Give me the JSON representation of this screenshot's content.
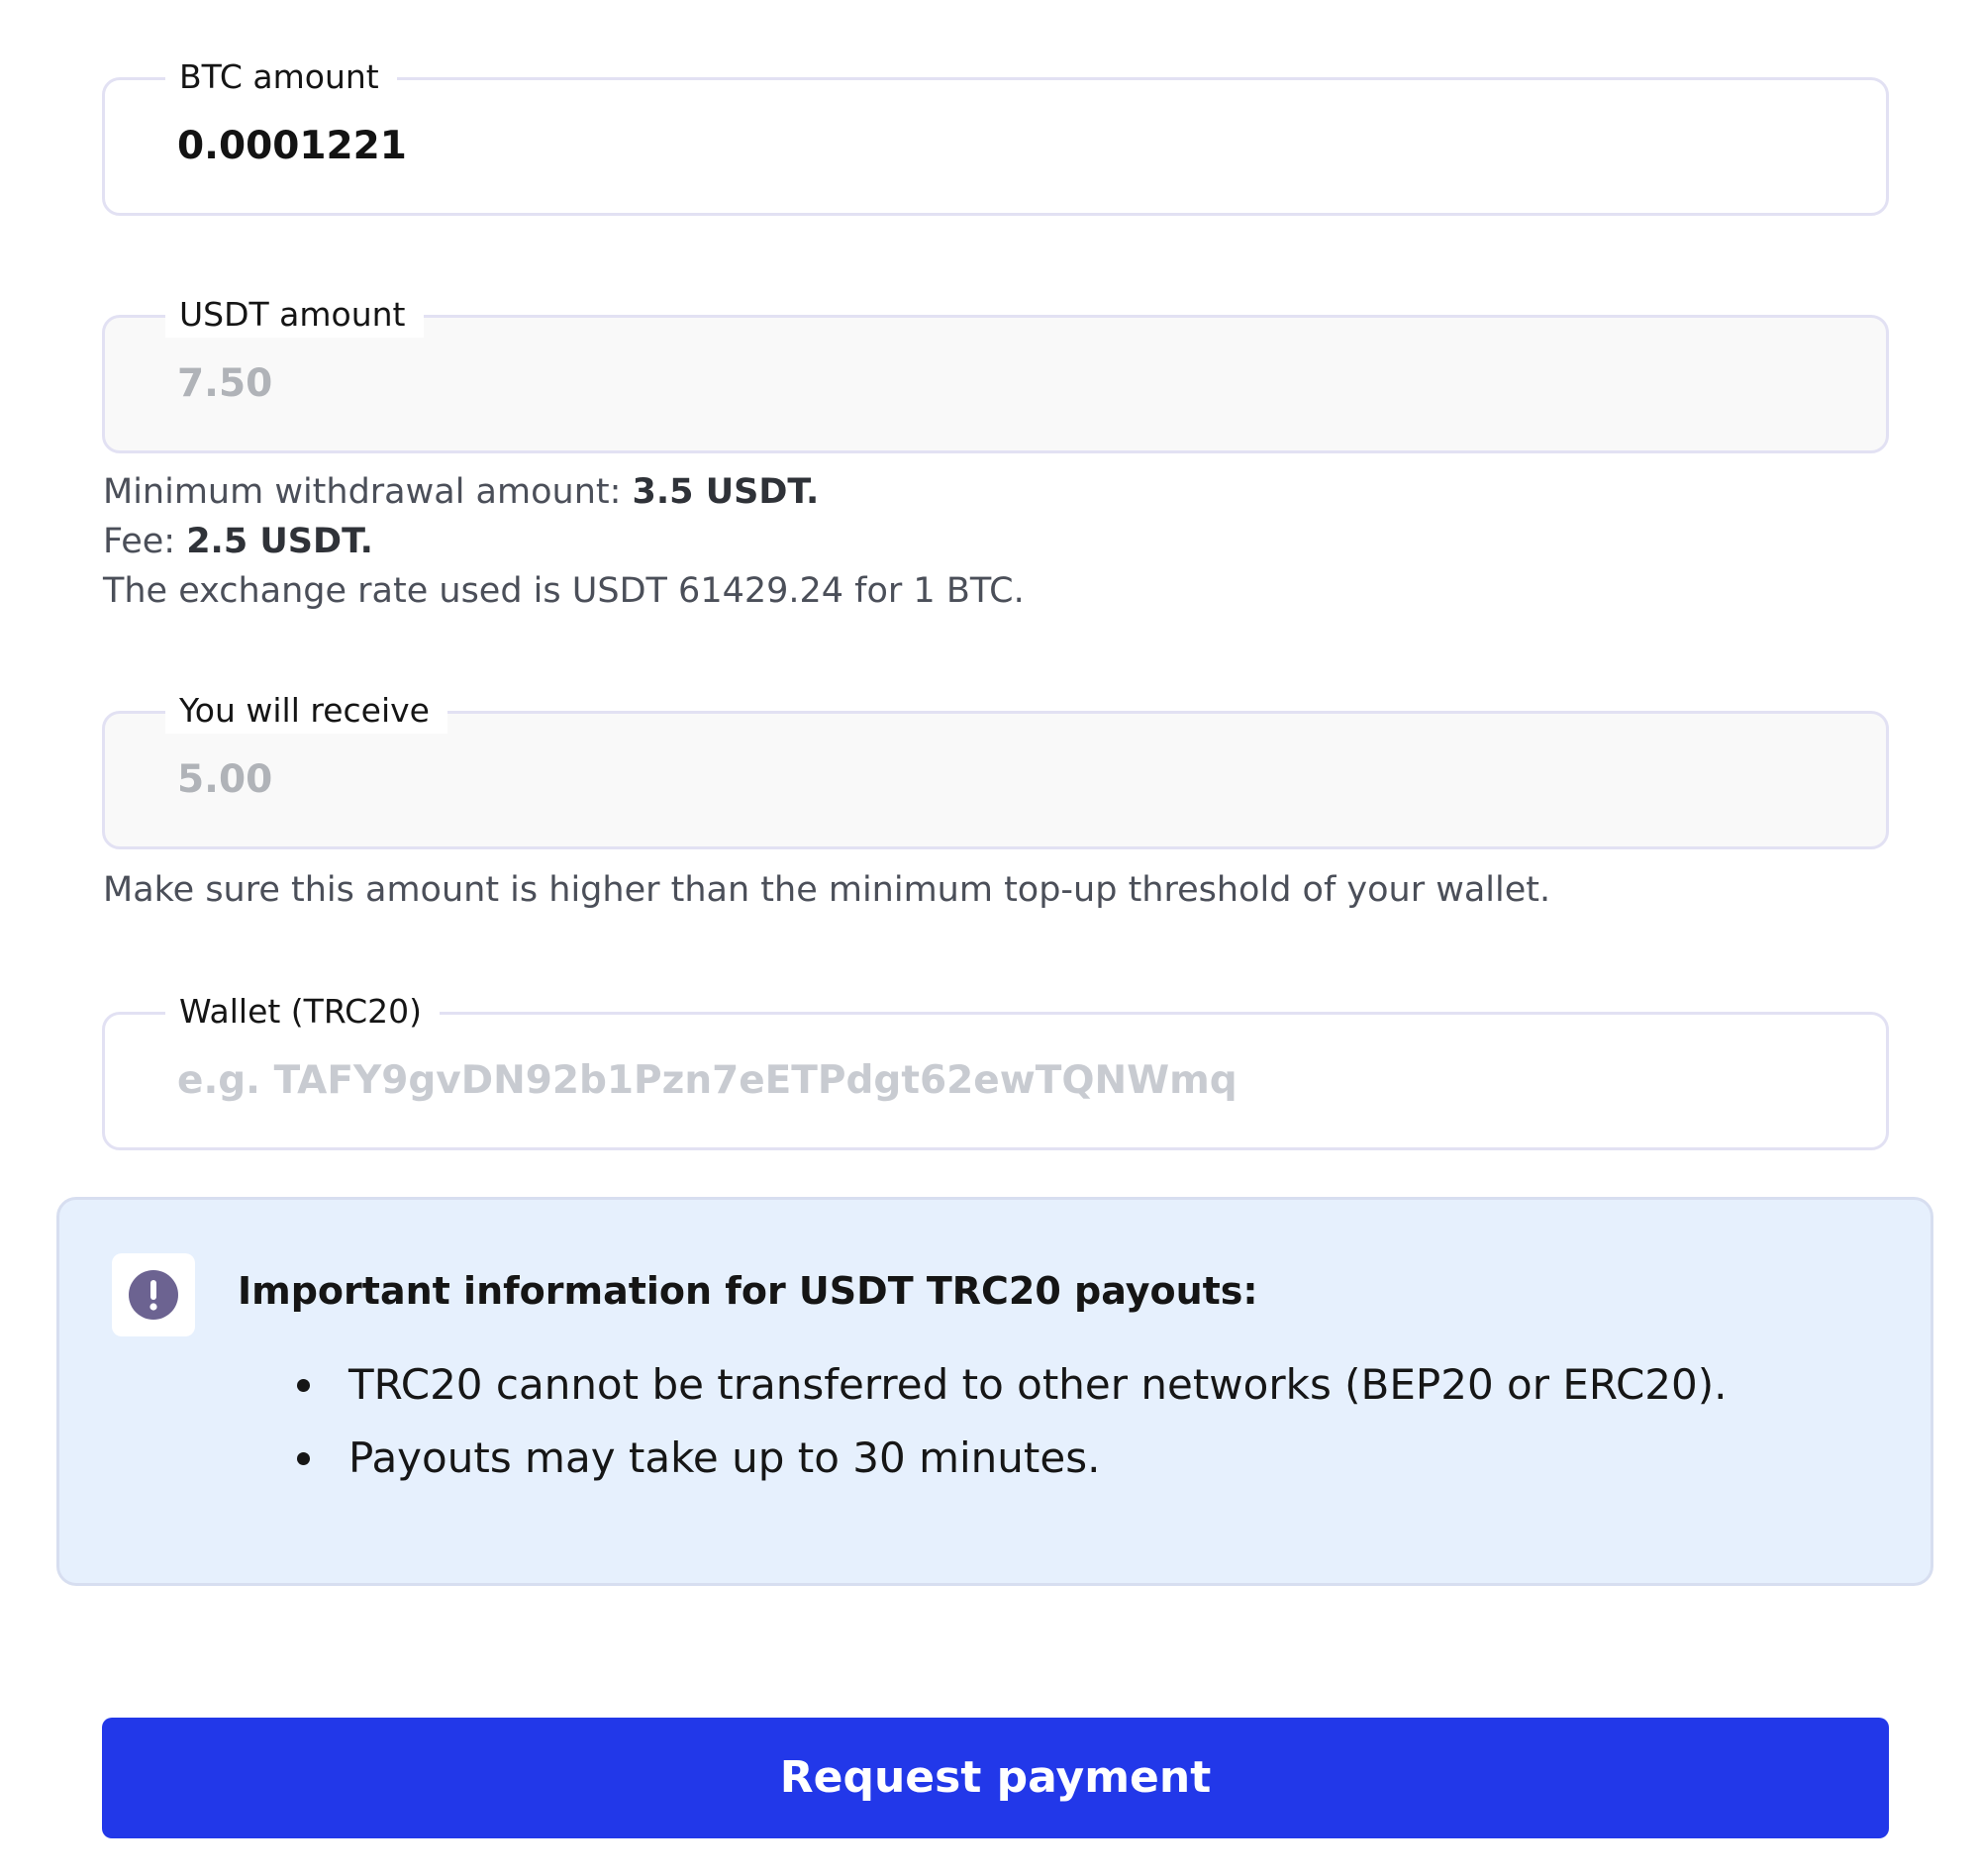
{
  "form": {
    "btc_amount": {
      "label": "BTC amount",
      "value": "0.0001221"
    },
    "usdt_amount": {
      "label": "USDT amount",
      "value": "7.50"
    },
    "info_lines": {
      "min_withdrawal_prefix": "Minimum withdrawal amount: ",
      "min_withdrawal_value": "3.5 USDT.",
      "fee_prefix": "Fee: ",
      "fee_value": "2.5 USDT.",
      "exchange_rate": "The exchange rate used is USDT 61429.24 for 1 BTC."
    },
    "receive_amount": {
      "label": "You will receive",
      "value": "5.00"
    },
    "receive_helper": "Make sure this amount is higher than the minimum top-up threshold of your wallet.",
    "wallet": {
      "label": "Wallet (TRC20)",
      "placeholder": "e.g. TAFY9gvDN92b1Pzn7eETPdgt62ewTQNWmq"
    }
  },
  "notice": {
    "icon": "exclamation-circle-icon",
    "title": "Important information for USDT TRC20 payouts:",
    "items": [
      "TRC20 cannot be transferred to other networks (BEP20 or ERC20).",
      "Payouts may take up to 30 minutes."
    ]
  },
  "submit": {
    "label": "Request payment"
  },
  "colors": {
    "primary": "#2238e9",
    "notice_background": "#e6f0fd",
    "notice_icon": "#6c6391",
    "field_border": "#e2e1f3"
  }
}
